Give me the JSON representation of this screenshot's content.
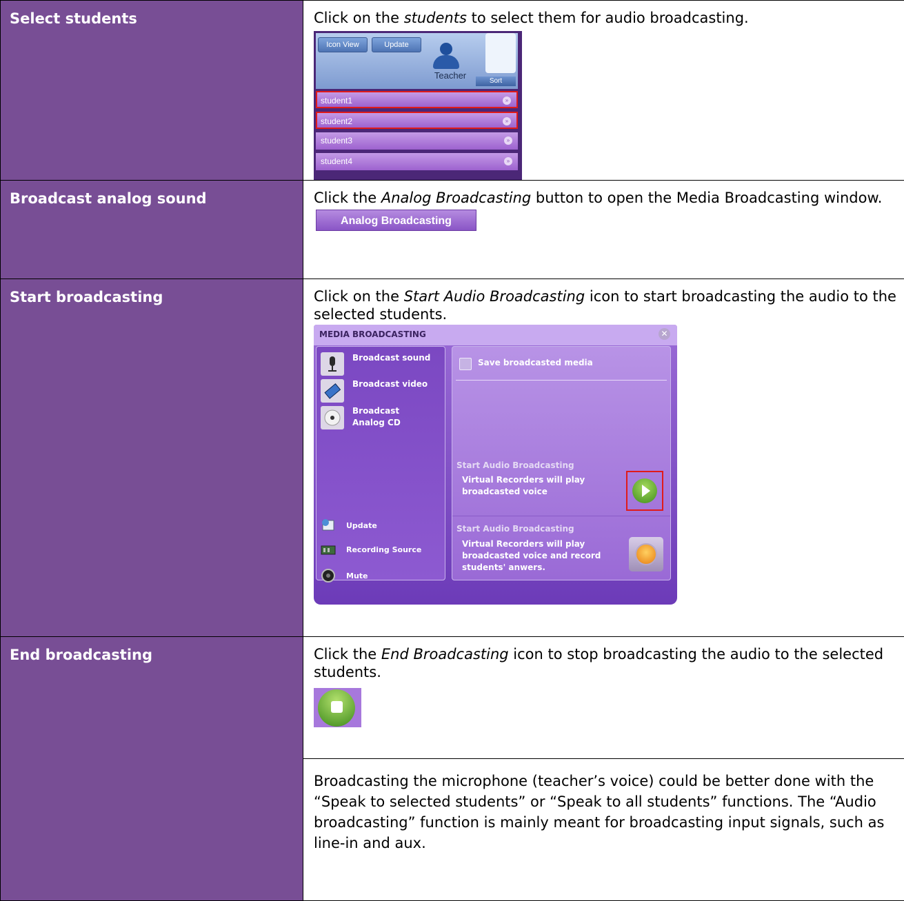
{
  "rows": [
    {
      "label": "Select students",
      "desc_pre": "Click on the ",
      "desc_em": "students",
      "desc_post": " to select them for audio broadcasting."
    },
    {
      "label": "Broadcast analog sound",
      "desc_pre": "Click the ",
      "desc_em": "Analog Broadcasting",
      "desc_post": " button to open the Media Broadcasting window."
    },
    {
      "label": "Start broadcasting",
      "desc_pre": "Click on the ",
      "desc_em": "Start Audio Broadcasting",
      "desc_post": " icon to start broadcasting the audio to the selected students."
    },
    {
      "label": "End broadcasting",
      "desc_pre": "Click the ",
      "desc_em": "End Broadcasting",
      "desc_post": " icon to stop broadcasting the audio to the selected students."
    }
  ],
  "note": "Broadcasting the microphone (teacher’s voice) could be better done with the “Speak to selected students” or “Speak to all students” functions. The “Audio broadcasting” function is mainly meant for broadcasting input signals, such as line-in and aux.",
  "shot1": {
    "icon_view": "Icon View",
    "update": "Update",
    "teacher": "Teacher",
    "sort": "Sort",
    "students": [
      "student1",
      "student2",
      "student3",
      "student4"
    ]
  },
  "analog_button": "Analog Broadcasting",
  "media": {
    "title": "MEDIA BROADCASTING",
    "close": "✕",
    "broadcast_sound": "Broadcast sound",
    "broadcast_video": "Broadcast video",
    "broadcast_cd_1": "Broadcast",
    "broadcast_cd_2": "Analog CD",
    "update": "Update",
    "recording_source": "Recording Source",
    "mute": "Mute",
    "save_media": "Save broadcasted media",
    "sec1_title": "Start Audio Broadcasting",
    "sec1_line1": "Virtual Recorders will play",
    "sec1_line2": "broadcasted voice",
    "sec2_title": "Start Audio Broadcasting",
    "sec2_line1": "Virtual Recorders will play",
    "sec2_line2": "broadcasted voice and record",
    "sec2_line3": "students' anwers."
  },
  "colors": {
    "label_cell": "#784e95",
    "selection_border": "#e01a1a"
  }
}
